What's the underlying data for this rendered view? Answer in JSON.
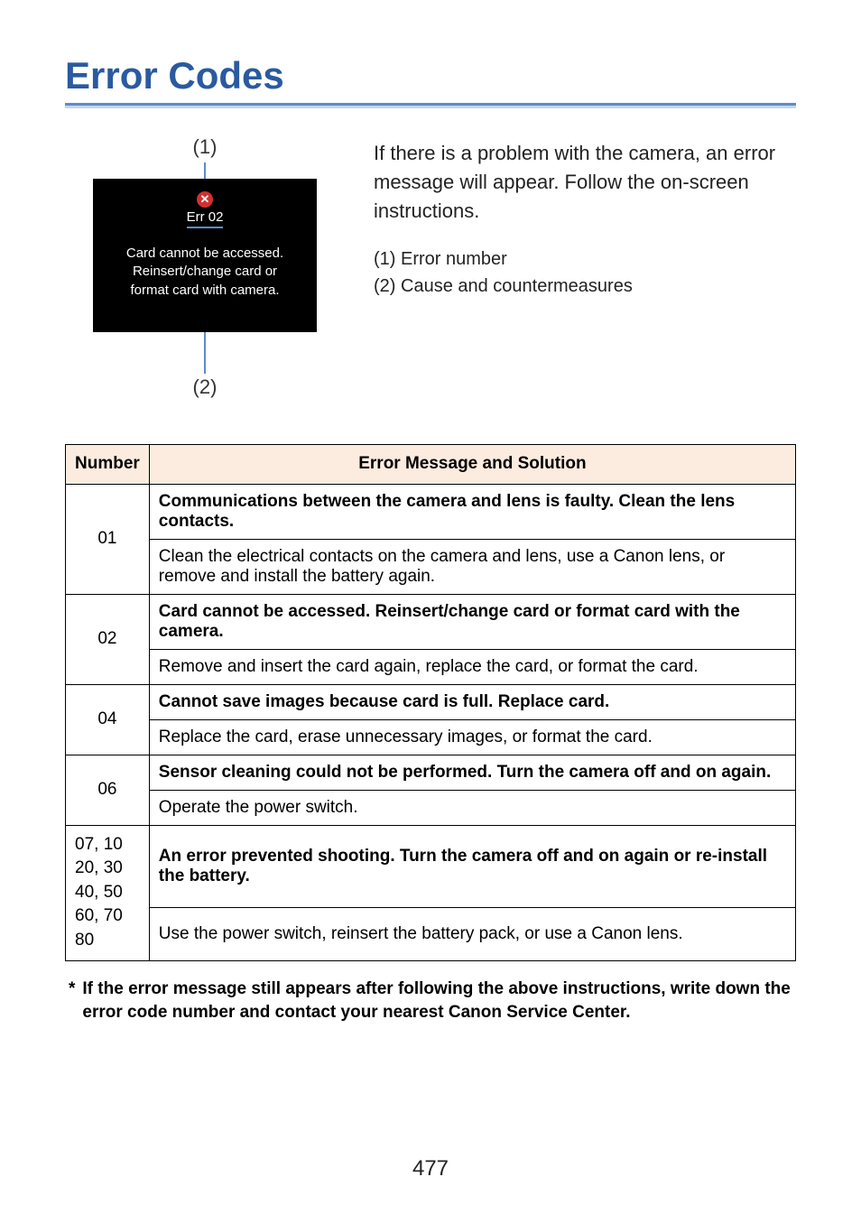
{
  "title": "Error Codes",
  "diagram": {
    "callout_top": "(1)",
    "err_code": "Err 02",
    "err_msg_line1": "Card cannot be accessed.",
    "err_msg_line2": "Reinsert/change card or",
    "err_msg_line3": "format card with camera.",
    "callout_bottom": "(2)"
  },
  "intro": "If there is a problem with the camera, an error message will appear. Follow the on-screen instructions.",
  "legend": [
    "(1)  Error number",
    "(2)  Cause and countermeasures"
  ],
  "table": {
    "headers": [
      "Number",
      "Error Message and Solution"
    ],
    "rows": [
      {
        "num": "01",
        "bold": "Communications between the camera and lens is faulty. Clean the lens contacts.",
        "plain": "Clean the electrical contacts on the camera and lens, use a Canon lens, or remove and install the battery again."
      },
      {
        "num": "02",
        "bold": "Card cannot be accessed. Reinsert/change card or format card with the camera.",
        "plain": "Remove and insert the card again, replace the card, or format the card."
      },
      {
        "num": "04",
        "bold": "Cannot save images because card is full. Replace card.",
        "plain": "Replace the card, erase unnecessary images, or format the card."
      },
      {
        "num": "06",
        "bold": "Sensor cleaning could not be performed. Turn the camera off and on again.",
        "plain": "Operate the power switch."
      },
      {
        "num": "07, 10\n20, 30\n40, 50\n60, 70\n80",
        "bold": "An error prevented shooting. Turn the camera off and on again or re-install the battery.",
        "plain": "Use the power switch, reinsert the battery pack, or use a Canon lens."
      }
    ]
  },
  "footnote": "If the error message still appears after following the above instructions, write down the error code number and contact your nearest Canon Service Center.",
  "page_number": "477"
}
